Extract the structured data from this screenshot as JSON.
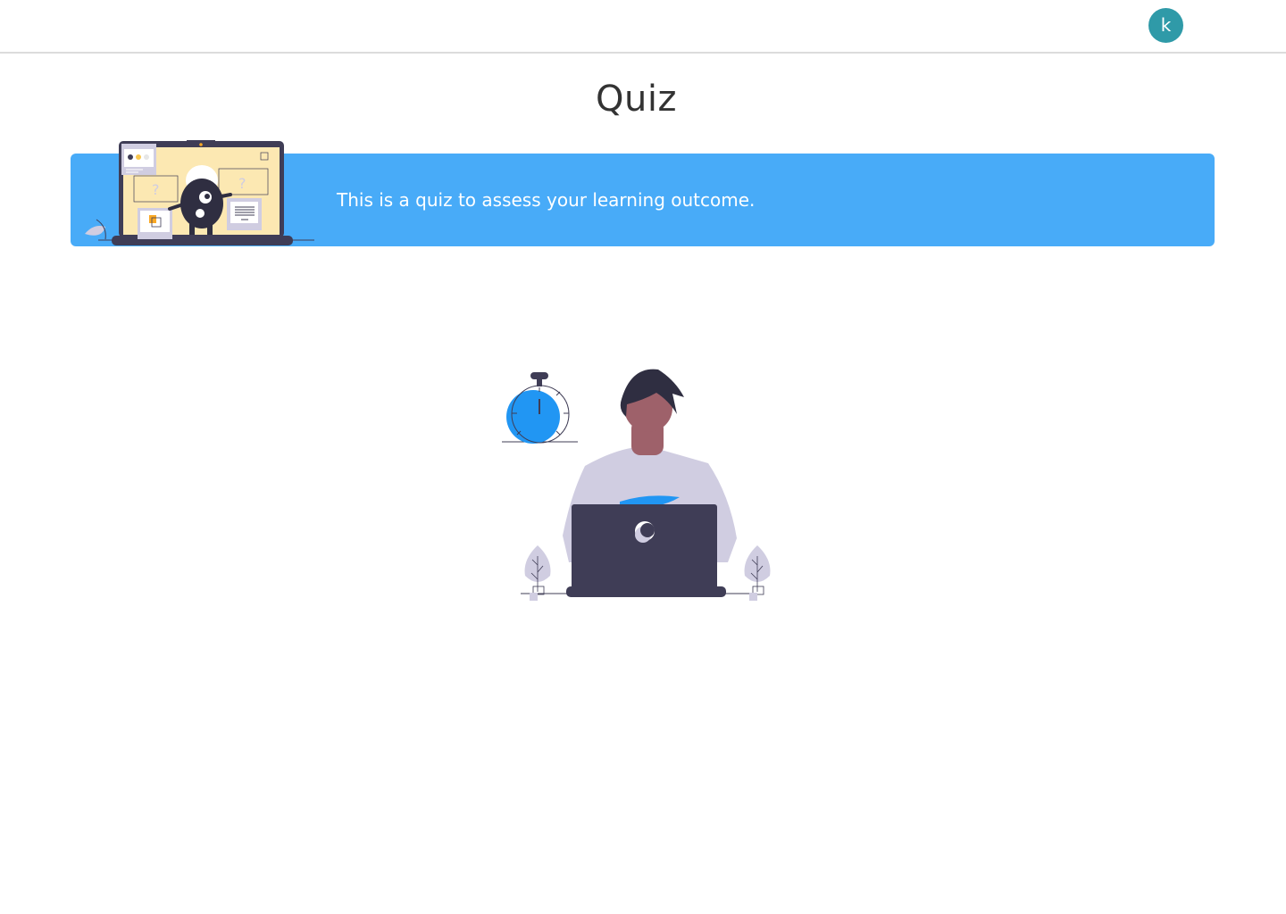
{
  "header": {
    "avatar_initial": "k"
  },
  "main": {
    "title": "Quiz",
    "banner_text": "This is a quiz to assess your learning outcome."
  },
  "colors": {
    "accent": "#48abf8",
    "avatar_bg": "#2f9aa8",
    "illustration_dark": "#3f3d56",
    "illustration_blue": "#2196f3"
  },
  "icons": {
    "banner": "teacher-laptop-illustration",
    "hero": "person-laptop-stopwatch-illustration"
  }
}
